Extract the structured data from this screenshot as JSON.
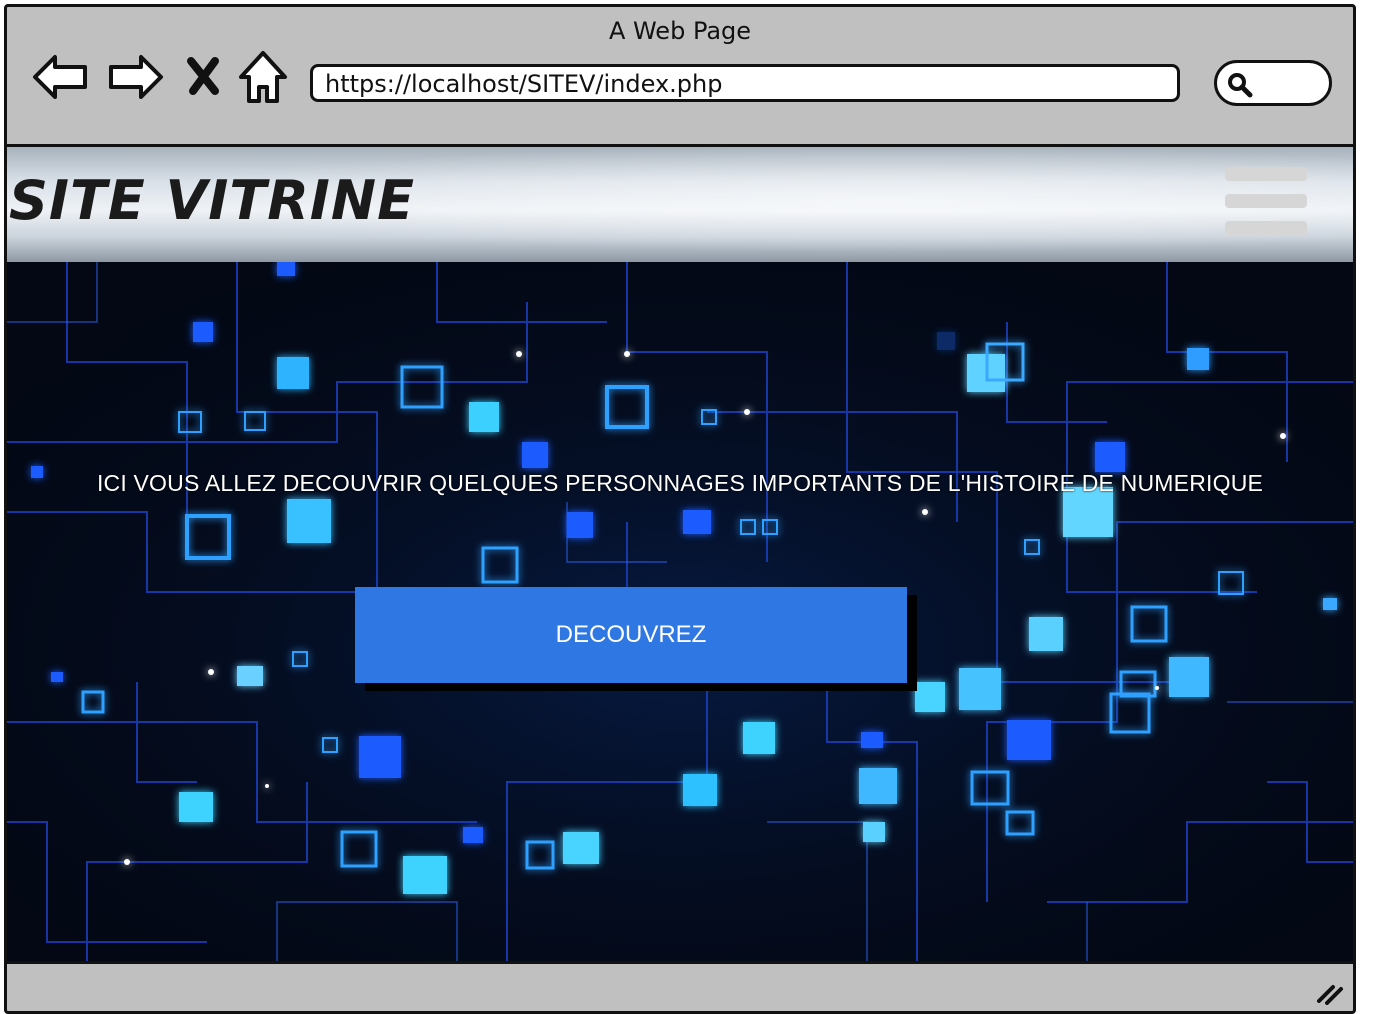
{
  "window": {
    "title": "A Web Page"
  },
  "toolbar": {
    "back_icon": "back-arrow-icon",
    "forward_icon": "forward-arrow-icon",
    "stop_icon": "close-x-icon",
    "home_icon": "home-icon",
    "address": "https://localhost/SITEV/index.php",
    "search_icon": "search-icon"
  },
  "header": {
    "site_title": "SITE VITRINE",
    "menu_icon": "hamburger-menu-icon"
  },
  "hero": {
    "tagline": "ICI VOUS ALLEZ DECOUVRIR QUELQUES PERSONNAGES IMPORTANTS DE L'HISTOIRE DE NUMERIQUE",
    "cta_label": "DECOUVREZ",
    "background": "blue circuit / digital network image"
  },
  "colors": {
    "chrome": "#c0c0c0",
    "cta": "#2f77e2",
    "hero_bg": "#030814",
    "glow": "#3aa8ff"
  }
}
